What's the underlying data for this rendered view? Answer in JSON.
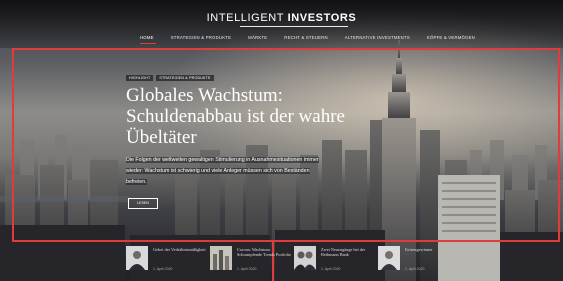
{
  "header": {
    "logo_part1": "INTELLIGENT ",
    "logo_part2": "INVESTORS",
    "nav": [
      "HOME",
      "STRATEGIEN & PRODUKTE",
      "MÄRKTE",
      "RECHT & STEUERN",
      "ALTERNATIVE INVESTMENTS",
      "KÖPFE & VERMÖGEN"
    ],
    "active_nav_index": 0
  },
  "hero": {
    "badges": [
      "HIGHLIGHT",
      "STRATEGIEN & PRODUKTE"
    ],
    "headline": "Globales Wachstum: Schuldenabbau ist der wahre Übeltäter",
    "teaser": "Die Folgen der weltweiten gewaltigen Stimulierung in Ausnahmesituationen immer wieder: Wachstum ist schwierig und viele Anleger müssen sich von Beständen befreien.",
    "button_label": "LESEN",
    "accent_color": "#e23b3b"
  },
  "cards": [
    {
      "title": "Gebot der Verhältnismäßigkeit",
      "date": "1. April 2020"
    },
    {
      "title": "Corona: Wachstum Schrumpfende Trends Portfolio",
      "date": "1. April 2020"
    },
    {
      "title": "Zwei Neuzugänge bei der Bethmann Bank",
      "date": "1. April 2020"
    },
    {
      "title": "Krisengewinner",
      "date": "1. April 2020"
    }
  ]
}
